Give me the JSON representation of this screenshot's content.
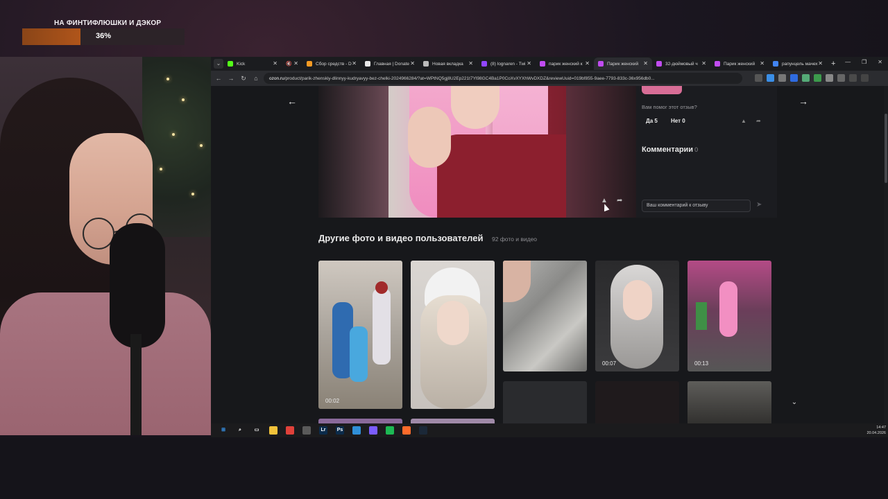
{
  "overlay": {
    "goal_title": "НА ФИНТИФЛЮШКИ И ДЭКОР",
    "goal_percent_text": "36%",
    "goal_progress": 0.36
  },
  "browser": {
    "tabs": [
      {
        "label": "Kick",
        "icon_color": "#53fc18",
        "active": false
      },
      {
        "label": "",
        "icon": "speaker-muted-icon",
        "active": false
      },
      {
        "label": "Сбор средств - D",
        "icon_color": "#f59a23",
        "active": false
      },
      {
        "label": "Главная | Donate",
        "icon_color": "#e8e8e8",
        "active": false
      },
      {
        "label": "Новая вкладка",
        "icon_color": "#bbbbbb",
        "active": false
      },
      {
        "label": "(8) lognaren - Twi",
        "icon_color": "#9146ff",
        "active": false
      },
      {
        "label": "парик женский к",
        "icon_color": "#c04cf0",
        "active": false
      },
      {
        "label": "Парик женский ",
        "icon_color": "#c04cf0",
        "active": true
      },
      {
        "label": "32-дюймовый ч",
        "icon_color": "#c04cf0",
        "active": false
      },
      {
        "label": "Парик женский ",
        "icon_color": "#c04cf0",
        "active": false
      },
      {
        "label": "рапунцель мачех",
        "icon_color": "#4285f4",
        "active": false
      }
    ],
    "url_domain": "ozon.ru",
    "url_rest": "/product/parik-zhenskiy-dlinnyy-kudryavyy-bez-chelki-2024966284/?at=WPtNQ5gj8U2Ep221t7Yl98GC4Ba1P0CoXvXYXhWvDXDZ&reviewUuid=019bf855-9aee-7793-833c-36x956db0..."
  },
  "review": {
    "helpful_question": "Вам помог этот отзыв?",
    "yes_label": "Да 5",
    "no_label": "Нет 0",
    "comments_title": "Комментарии",
    "comments_count": "0",
    "comment_placeholder": "Ваш комментарий к отзыву"
  },
  "gallery": {
    "title": "Другие фото и видео пользователей",
    "count": "92 фото и видео",
    "items": [
      {
        "duration": "00:02",
        "type": "video"
      },
      {
        "duration": "",
        "type": "photo"
      },
      {
        "duration": "",
        "type": "photo"
      },
      {
        "duration": "00:07",
        "type": "video"
      },
      {
        "duration": "00:13",
        "type": "video"
      }
    ]
  },
  "taskbar": {
    "time": "14:47",
    "date": "20.04.2026",
    "apps": [
      "start-icon",
      "search-icon",
      "task-view-icon",
      "file-explorer-icon",
      "chrome-icon",
      "obs-icon",
      "lightroom-icon",
      "photoshop-icon",
      "edge-icon",
      "app-grid-icon",
      "spotify-icon",
      "firefox-icon",
      "steam-icon"
    ]
  },
  "colors": {
    "accent_goal": "#b0551a",
    "ozon_dark_bg": "#17181b"
  }
}
